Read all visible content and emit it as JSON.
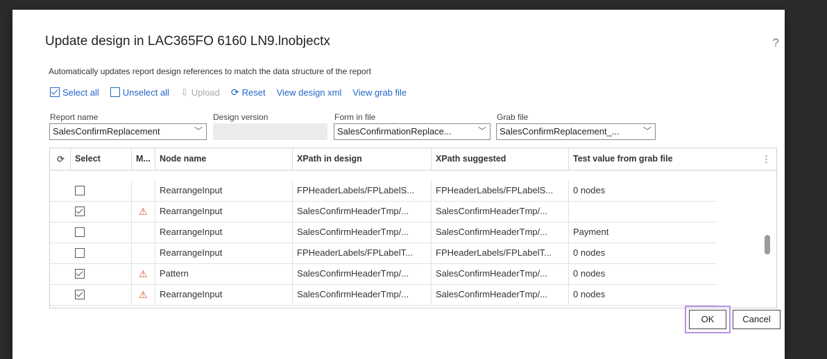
{
  "dialog": {
    "title": "Update design in LAC365FO 6160 LN9.lnobjectx",
    "description": "Automatically updates report design references to match the data structure of the report",
    "help_glyph": "?"
  },
  "toolbar": {
    "select_all": "Select all",
    "unselect_all": "Unselect all",
    "upload": "Upload",
    "reset": "Reset",
    "view_design_xml": "View design xml",
    "view_grab_file": "View grab file"
  },
  "fields": {
    "report_name": {
      "label": "Report name",
      "value": "SalesConfirmReplacement"
    },
    "design_version": {
      "label": "Design version",
      "value": ""
    },
    "form_in_file": {
      "label": "Form in file",
      "value": "SalesConfirmationReplace..."
    },
    "grab_file": {
      "label": "Grab file",
      "value": "SalesConfirmReplacement_..."
    }
  },
  "grid": {
    "columns": [
      "Select",
      "M...",
      "Node name",
      "XPath in design",
      "XPath suggested",
      "Test value from grab file"
    ],
    "rows": [
      {
        "selected": false,
        "warning": false,
        "node": "RearrangeInput",
        "xpath_design": "FPHeaderLabels/FPLabelS...",
        "xpath_suggested": "FPHeaderLabels/FPLabelS...",
        "test_value": "0 nodes"
      },
      {
        "selected": true,
        "warning": true,
        "node": "RearrangeInput",
        "xpath_design": "SalesConfirmHeaderTmp/...",
        "xpath_suggested": "SalesConfirmHeaderTmp/...",
        "test_value": ""
      },
      {
        "selected": false,
        "warning": false,
        "node": "RearrangeInput",
        "xpath_design": "SalesConfirmHeaderTmp/...",
        "xpath_suggested": "SalesConfirmHeaderTmp/...",
        "test_value": "Payment"
      },
      {
        "selected": false,
        "warning": false,
        "node": "RearrangeInput",
        "xpath_design": "FPHeaderLabels/FPLabelT...",
        "xpath_suggested": "FPHeaderLabels/FPLabelT...",
        "test_value": "0 nodes"
      },
      {
        "selected": true,
        "warning": true,
        "node": "Pattern",
        "xpath_design": "SalesConfirmHeaderTmp/...",
        "xpath_suggested": "SalesConfirmHeaderTmp/...",
        "test_value": "0 nodes"
      },
      {
        "selected": true,
        "warning": true,
        "node": "RearrangeInput",
        "xpath_design": "SalesConfirmHeaderTmp/...",
        "xpath_suggested": "SalesConfirmHeaderTmp/...",
        "test_value": "0 nodes"
      }
    ]
  },
  "buttons": {
    "ok": "OK",
    "cancel": "Cancel"
  },
  "colors": {
    "link": "#2266c4",
    "warning": "#d9532f",
    "focus_ring": "#b890e4"
  }
}
